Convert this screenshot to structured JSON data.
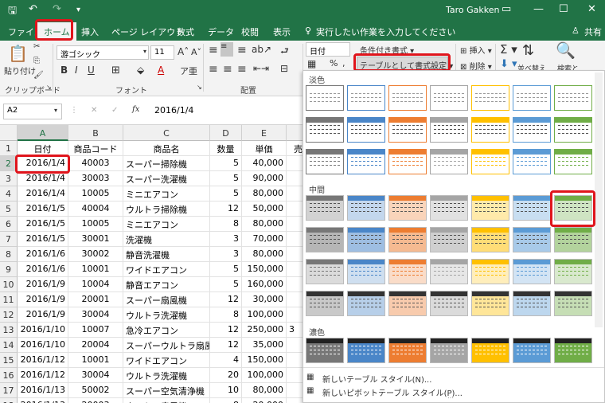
{
  "title": {
    "user": "Taro Gakken",
    "share": "共有"
  },
  "tabs": [
    "ファイル",
    "ホーム",
    "挿入",
    "ページ レイアウト",
    "数式",
    "データ",
    "校閲",
    "表示"
  ],
  "tellme": "実行したい作業を入力してください",
  "ribbon": {
    "paste": "貼り付け",
    "clipboard": "クリップボード",
    "font_name": "游ゴシック",
    "font_size": "11",
    "font_group": "フォント",
    "align_group": "配置",
    "number_format": "日付",
    "percent": "%",
    "cond_format": "条件付き書式",
    "table_format": "テーブルとして書式設定",
    "insert": "挿入",
    "delete": "削除",
    "sort": "並べ替え",
    "search": "検索と"
  },
  "formula": {
    "name_box": "A2",
    "fx": "fx",
    "value": "2016/1/4"
  },
  "columns": [
    "A",
    "B",
    "C",
    "D",
    "E"
  ],
  "headers": [
    "日付",
    "商品コード",
    "商品名",
    "数量",
    "単価",
    "売"
  ],
  "rows": [
    [
      "2016/1/4",
      "40003",
      "スーパー掃除機",
      "5",
      "40,000",
      ""
    ],
    [
      "2016/1/4",
      "30003",
      "スーパー洗濯機",
      "5",
      "90,000",
      ""
    ],
    [
      "2016/1/4",
      "10005",
      "ミニエアコン",
      "5",
      "80,000",
      ""
    ],
    [
      "2016/1/5",
      "40004",
      "ウルトラ掃除機",
      "12",
      "50,000",
      ""
    ],
    [
      "2016/1/5",
      "10005",
      "ミニエアコン",
      "8",
      "80,000",
      ""
    ],
    [
      "2016/1/5",
      "30001",
      "洗濯機",
      "3",
      "70,000",
      ""
    ],
    [
      "2016/1/6",
      "30002",
      "静音洗濯機",
      "3",
      "80,000",
      ""
    ],
    [
      "2016/1/6",
      "10001",
      "ワイドエアコン",
      "5",
      "150,000",
      ""
    ],
    [
      "2016/1/9",
      "10004",
      "静音エアコン",
      "5",
      "160,000",
      ""
    ],
    [
      "2016/1/9",
      "20001",
      "スーパー扇風機",
      "12",
      "30,000",
      ""
    ],
    [
      "2016/1/9",
      "30004",
      "ウルトラ洗濯機",
      "8",
      "100,000",
      ""
    ],
    [
      "2016/1/10",
      "10007",
      "急冷エアコン",
      "12",
      "250,000",
      "3"
    ],
    [
      "2016/1/10",
      "20004",
      "スーパーウルトラ扇風",
      "12",
      "35,000",
      ""
    ],
    [
      "2016/1/12",
      "10001",
      "ワイドエアコン",
      "4",
      "150,000",
      ""
    ],
    [
      "2016/1/12",
      "30004",
      "ウルトラ洗濯機",
      "20",
      "100,000",
      ""
    ],
    [
      "2016/1/13",
      "50002",
      "スーパー空気清浄機",
      "10",
      "80,000",
      ""
    ],
    [
      "2016/1/13",
      "20003",
      "ウルトラ扇風機",
      "8",
      "20,000",
      ""
    ]
  ],
  "row_numbers": [
    "1",
    "2",
    "3",
    "4",
    "5",
    "6",
    "7",
    "8",
    "9",
    "10",
    "11",
    "12",
    "13",
    "14",
    "15",
    "16",
    "17",
    "18"
  ],
  "panel": {
    "light": "淡色",
    "medium": "中間",
    "dark": "濃色",
    "new_table_style": "新しいテーブル スタイル(N)...",
    "new_pivot_style": "新しいピボットテーブル スタイル(P)..."
  },
  "colors": {
    "excel_green": "#217346",
    "highlight": "#e0151c"
  },
  "swatch_colors": [
    "#777777",
    "#4a86c8",
    "#ed7d31",
    "#a5a5a5",
    "#ffc000",
    "#5b9bd5",
    "#70ad47"
  ]
}
